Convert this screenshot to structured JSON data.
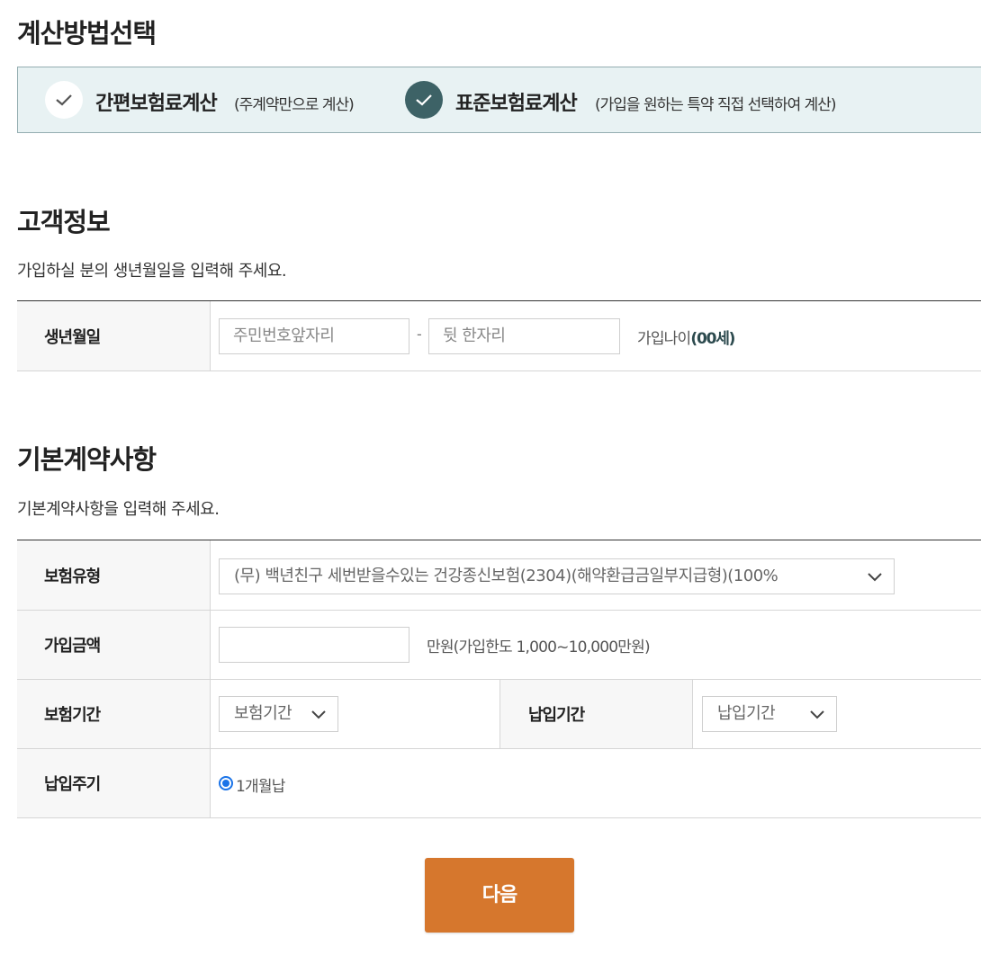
{
  "method": {
    "title": "계산방법선택",
    "options": [
      {
        "label": "간편보험료계산",
        "sub": "(주계약만으로 계산)",
        "selected": false
      },
      {
        "label": "표준보험료계산",
        "sub": "(가입을 원하는 특약 직접 선택하여 계산)",
        "selected": true
      }
    ],
    "selected_color": "#3d6266",
    "box_bg": "#e8f2f3"
  },
  "customer": {
    "title": "고객정보",
    "desc": "가입하실 분의 생년월일을 입력해 주세요.",
    "birth_label": "생년월일",
    "front_placeholder": "주민번호앞자리",
    "separator": "-",
    "back_placeholder": "뒷 한자리",
    "age_prefix": "가입나이",
    "age_value": "(00세)"
  },
  "contract": {
    "title": "기본계약사항",
    "desc": "기본계약사항을 입력해 주세요.",
    "type_label": "보험유형",
    "type_value": "(무) 백년친구 세번받을수있는 건강종신보험(2304)(해약환급금일부지급형)(100%",
    "amount_label": "가입금액",
    "amount_value": "",
    "amount_hint": "만원(가입한도 1,000~10,000만원)",
    "period_label": "보험기간",
    "period_value": "보험기간",
    "pay_period_label": "납입기간",
    "pay_period_value": "납입기간",
    "pay_cycle_label": "납입주기",
    "pay_cycle_option": "1개월납"
  },
  "next_button": "다음",
  "colors": {
    "accent": "#d6772d",
    "radio": "#1a73e8"
  }
}
